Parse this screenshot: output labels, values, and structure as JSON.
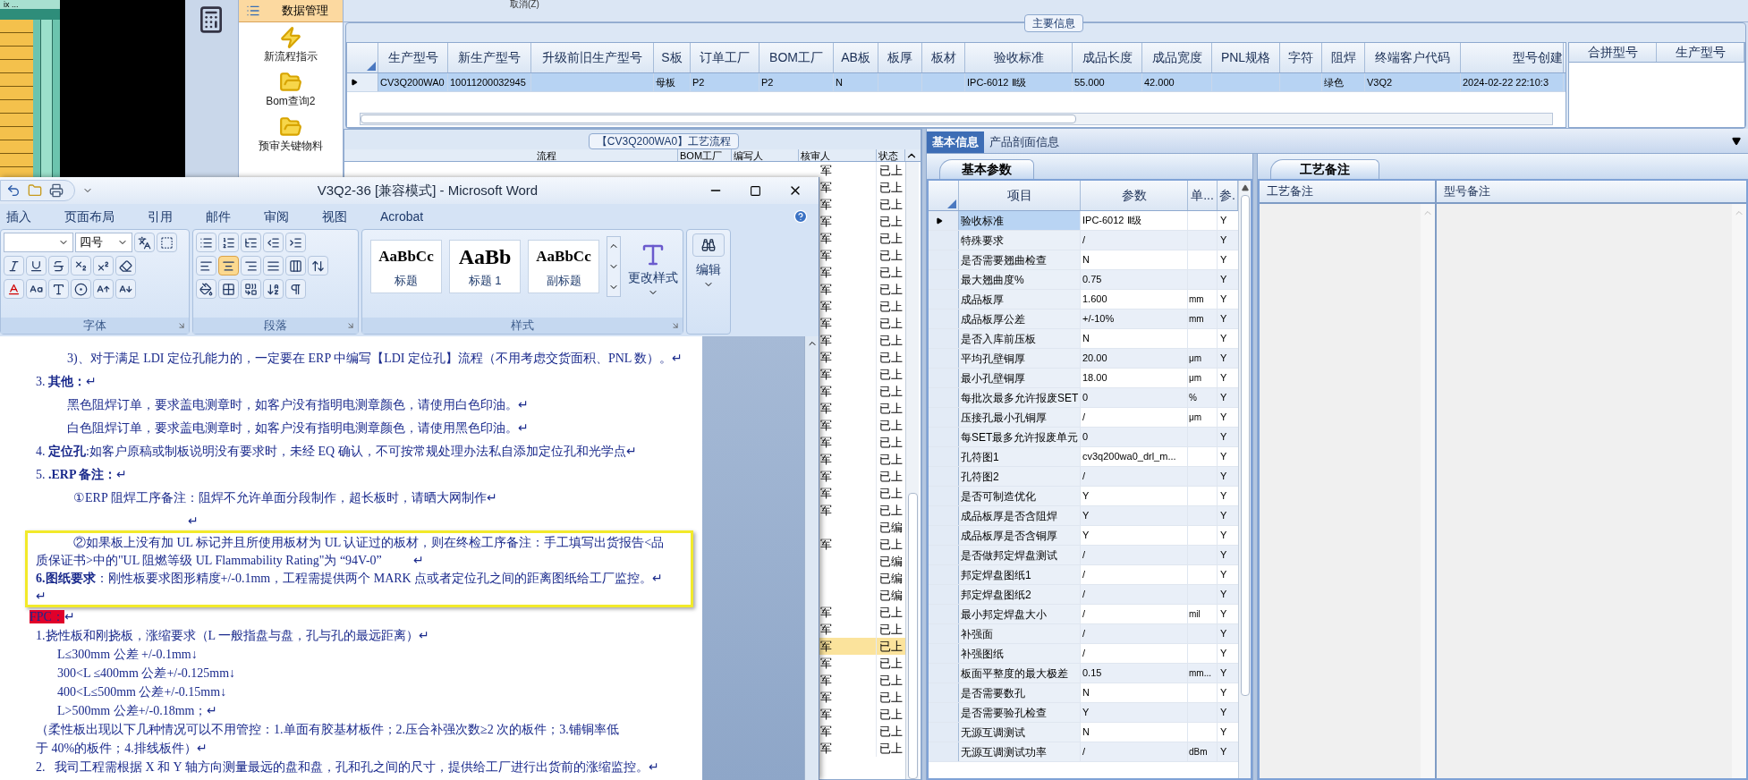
{
  "left_app": {
    "title_fragment": "ix ..."
  },
  "toolbar": {
    "cancel": "取消(Z)"
  },
  "nav": {
    "items": [
      {
        "label": "数据管理",
        "selected": true,
        "kind": "header"
      },
      {
        "label": "新流程指示",
        "selected": false,
        "kind": "flash"
      },
      {
        "label": "Bom查询2",
        "selected": false,
        "kind": "folder"
      },
      {
        "label": "预审关键物料",
        "selected": false,
        "kind": "folder"
      }
    ]
  },
  "main_info": {
    "title": "主要信息",
    "columns": [
      "生产型号",
      "新生产型号",
      "升级前旧生产型号",
      "S板",
      "订单工厂",
      "BOM工厂",
      "AB板",
      "板厚",
      "板材",
      "验收标准",
      "成品长度",
      "成品宽度",
      "PNL规格",
      "字符",
      "阻焊",
      "终端客户代码",
      "型号创建"
    ],
    "rows": [
      {
        "selected": true,
        "cells": [
          "CV3Q200WA0",
          "10011200032945",
          null,
          "母板",
          "P2",
          "P2",
          "N",
          null,
          null,
          "IPC-6012 Ⅱ级",
          "55.000",
          "42.000",
          null,
          null,
          "绿色",
          "V3Q2",
          "2024-02-22 22:10:3"
        ]
      }
    ],
    "side_columns": [
      "合拼型号",
      "生产型号"
    ]
  },
  "flow": {
    "title": "【CV3Q200WA0】工艺流程",
    "columns": [
      "流程",
      "BOM工厂",
      "编写人",
      "核审人",
      "状态"
    ],
    "rows": [
      {
        "reviewer": "军",
        "status": "已上",
        "selected": false
      },
      {
        "reviewer": "军",
        "status": "已上",
        "selected": false
      },
      {
        "reviewer": "军",
        "status": "已上",
        "selected": false
      },
      {
        "reviewer": "军",
        "status": "已上",
        "selected": false
      },
      {
        "reviewer": "军",
        "status": "已上",
        "selected": false
      },
      {
        "reviewer": "军",
        "status": "已上",
        "selected": false
      },
      {
        "reviewer": "军",
        "status": "已上",
        "selected": false
      },
      {
        "reviewer": "军",
        "status": "已上",
        "selected": false
      },
      {
        "reviewer": "军",
        "status": "已上",
        "selected": false
      },
      {
        "reviewer": "军",
        "status": "已上",
        "selected": false
      },
      {
        "reviewer": "军",
        "status": "已上",
        "selected": false
      },
      {
        "reviewer": "军",
        "status": "已上",
        "selected": false
      },
      {
        "reviewer": "军",
        "status": "已上",
        "selected": false
      },
      {
        "reviewer": "军",
        "status": "已上",
        "selected": false
      },
      {
        "reviewer": "军",
        "status": "已上",
        "selected": false
      },
      {
        "reviewer": "军",
        "status": "已上",
        "selected": false
      },
      {
        "reviewer": "军",
        "status": "已上",
        "selected": false
      },
      {
        "reviewer": "军",
        "status": "已上",
        "selected": false
      },
      {
        "reviewer": "军",
        "status": "已上",
        "selected": false
      },
      {
        "reviewer": "军",
        "status": "已上",
        "selected": false
      },
      {
        "reviewer": "军",
        "status": "已上",
        "selected": false
      },
      {
        "status": "已编",
        "selected": false
      },
      {
        "reviewer": "军",
        "status": "已上",
        "selected": false
      },
      {
        "status": "已编",
        "selected": false
      },
      {
        "status": "已编",
        "selected": false
      },
      {
        "status": "已编",
        "selected": false
      },
      {
        "reviewer": "军",
        "status": "已上",
        "selected": false
      },
      {
        "reviewer": "军",
        "status": "已上",
        "selected": false
      },
      {
        "reviewer": "军",
        "status": "已上",
        "selected": true
      },
      {
        "reviewer": "军",
        "status": "已上",
        "selected": false
      },
      {
        "reviewer": "军",
        "status": "已上",
        "selected": false
      },
      {
        "reviewer": "军",
        "status": "已上",
        "selected": false
      },
      {
        "reviewer": "军",
        "status": "已上",
        "selected": false
      },
      {
        "reviewer": "军",
        "status": "已上",
        "selected": false
      },
      {
        "reviewer": "军",
        "status": "已上",
        "selected": false
      }
    ]
  },
  "word": {
    "title": "V3Q2-36 [兼容模式] - Microsoft Word",
    "tabs": [
      "插入",
      "页面布局",
      "引用",
      "邮件",
      "审阅",
      "视图",
      "Acrobat"
    ],
    "font_size": "四号",
    "align_buttons": [
      {
        "selected": false
      },
      {
        "selected": true
      },
      {
        "selected": false
      },
      {
        "selected": false
      },
      {
        "selected": false
      }
    ],
    "styles": [
      {
        "preview": "AaBbCc",
        "label": "标题",
        "kind": "normal"
      },
      {
        "preview": "AaBb",
        "label": "标题 1",
        "kind": "large"
      },
      {
        "preview": "AaBbCc",
        "label": "副标题",
        "kind": "normal"
      }
    ],
    "change_styles": "更改样式",
    "edit": "编辑",
    "groups": [
      "字体",
      "段落",
      "样式"
    ],
    "document": {
      "before": [
        {
          "kind": "indent",
          "text": "3)、对于满足 LDI 定位孔能力的，一定要在 ERP 中编写【LDI 定位孔】流程（不用考虑交货面积、PNL 数）。↵"
        },
        {
          "kind": "plain",
          "text": "3. **其他：**↵"
        },
        {
          "kind": "indent",
          "text": "黑色阻焊订单，要求盖电测章时，如客户没有指明电测章颜色，请使用白色印油。↵"
        },
        {
          "kind": "indent",
          "text": "白色阻焊订单，要求盖电测章时，如客户没有指明电测章颜色，请使用黑色印油。↵"
        },
        {
          "kind": "plain",
          "text": "4. **定位孔**:如客户原稿或制板说明没有要求时，未经 EQ 确认，不可按常规处理办法私自添加定位孔和光学点↵"
        },
        {
          "kind": "plain",
          "text": "5. **.ERP 备注：**↵"
        },
        {
          "kind": "sub",
          "text": "①ERP 阻焊工序备注：阻焊不允许单面分段制作，超长板时，请晒大网制作↵"
        },
        {
          "kind": "mark",
          "text": "↵"
        }
      ],
      "highlighted": [
        {
          "kind": "sub",
          "text": "②如果板上没有加 UL 标记并且所使用板材为 UL 认证过的板材，则在终检工序备注：手工填写出货报告<品"
        },
        {
          "kind": "plain",
          "text": "质保证书>中的\"UL 阻燃等级 UL Flammability Rating\"为 “94V-0”          ↵"
        },
        {
          "kind": "plain",
          "text": "**6.图纸要求**：刚性板要求图形精度+/-0.1mm，工程需提供两个 MARK 点或者定位孔之间的距离图纸给工厂监控。↵"
        },
        {
          "kind": "plain",
          "text": "↵"
        }
      ],
      "after": [
        {
          "kind": "flag",
          "marked": "FPC：",
          "text": "↵"
        },
        {
          "kind": "plain",
          "text": "1.挠性板和刚挠板，涨缩要求（L 一般指盘与盘，孔与孔的最远距离）↵"
        },
        {
          "kind": "limit",
          "text": "L≤300mm 公差 +/-0.1mm↓"
        },
        {
          "kind": "limit",
          "text": "300<L ≤400mm 公差+/-0.125mm↓"
        },
        {
          "kind": "limit",
          "text": "400<L≤500mm 公差+/-0.15mm↓"
        },
        {
          "kind": "limit",
          "text": "L>500mm 公差+/-0.18mm；↵"
        },
        {
          "kind": "plain",
          "text": "（柔性板出现以下几种情况可以不用管控：1.单面有胶基材板件；2.压合补强次数≥2 次的板件；3.铺铜率低"
        },
        {
          "kind": "plain",
          "text": "于 40%的板件；4.排线板件）↵"
        },
        {
          "kind": "plain",
          "text": "2.   我司工程需根据 X 和 Y 轴方向测量最远的盘和盘，孔和孔之间的尺寸，提供给工厂进行出货前的涨缩监控。↵"
        }
      ]
    }
  },
  "details": {
    "tabs": [
      {
        "label": "基本信息",
        "selected": true
      },
      {
        "label": "产品剖面信息",
        "selected": false
      }
    ],
    "params": {
      "tab": "基本参数",
      "columns": [
        "项目",
        "参数",
        "单...",
        "参."
      ],
      "rows": [
        {
          "item": "验收标准",
          "value": "IPC-6012 Ⅱ级",
          "flag": "Y",
          "selected": true
        },
        {
          "item": "特殊要求",
          "value": "/",
          "flag": "Y",
          "selected": false
        },
        {
          "item": "是否需要翘曲检查",
          "value": "N",
          "flag": "Y",
          "selected": false
        },
        {
          "item": "最大翘曲度%",
          "value": "0.75",
          "flag": "Y",
          "selected": false
        },
        {
          "item": "成品板厚",
          "value": "1.600",
          "unit": "mm",
          "flag": "Y",
          "selected": false
        },
        {
          "item": "成品板厚公差",
          "value": "+/-10%",
          "unit": "mm",
          "flag": "Y",
          "selected": false
        },
        {
          "item": "是否入库前压板",
          "value": "N",
          "flag": "Y",
          "selected": false
        },
        {
          "item": "平均孔壁铜厚",
          "value": "20.00",
          "unit": "μm",
          "flag": "Y",
          "selected": false
        },
        {
          "item": "最小孔壁铜厚",
          "value": "18.00",
          "unit": "μm",
          "flag": "Y",
          "selected": false
        },
        {
          "item": "每批次最多允许报废SET",
          "value": "0",
          "unit": "%",
          "flag": "Y",
          "selected": false
        },
        {
          "item": "压接孔最小孔铜厚",
          "value": "/",
          "unit": "μm",
          "flag": "Y",
          "selected": false
        },
        {
          "item": "每SET最多允许报废单元",
          "value": "0",
          "flag": "Y",
          "selected": false
        },
        {
          "item": "孔符图1",
          "value": "cv3q200wa0_drl_m...",
          "flag": "Y",
          "selected": false
        },
        {
          "item": "孔符图2",
          "value": "/",
          "flag": "Y",
          "selected": false
        },
        {
          "item": "是否可制造优化",
          "value": "Y",
          "flag": "Y",
          "selected": false
        },
        {
          "item": "成品板厚是否含阻焊",
          "value": "Y",
          "flag": "Y",
          "selected": false
        },
        {
          "item": "成品板厚是否含铜厚",
          "value": "Y",
          "flag": "Y",
          "selected": false
        },
        {
          "item": "是否做邦定焊盘测试",
          "value": "/",
          "flag": "Y",
          "selected": false
        },
        {
          "item": "邦定焊盘图纸1",
          "value": "/",
          "flag": "Y",
          "selected": false
        },
        {
          "item": "邦定焊盘图纸2",
          "value": "/",
          "flag": "Y",
          "selected": false
        },
        {
          "item": "最小邦定焊盘大小",
          "value": "/",
          "unit": "mil",
          "flag": "Y",
          "selected": false
        },
        {
          "item": "补强面",
          "value": "/",
          "flag": "Y",
          "selected": false
        },
        {
          "item": "补强图纸",
          "value": "/",
          "flag": "Y",
          "selected": false
        },
        {
          "item": "板面平整度的最大极差",
          "value": "0.15",
          "unit": "mm...",
          "flag": "Y",
          "selected": false
        },
        {
          "item": "是否需要数孔",
          "value": "N",
          "flag": "Y",
          "selected": false
        },
        {
          "item": "是否需要验孔检查",
          "value": "Y",
          "flag": "Y",
          "selected": false
        },
        {
          "item": "无源互调测试",
          "value": "N",
          "flag": "Y",
          "selected": false
        },
        {
          "item": "无源互调测试功率",
          "value": "/",
          "unit": "dBm",
          "flag": "Y",
          "selected": false
        }
      ]
    },
    "remarks": {
      "tab": "工艺备注",
      "columns": [
        "工艺备注",
        "型号备注"
      ]
    }
  }
}
